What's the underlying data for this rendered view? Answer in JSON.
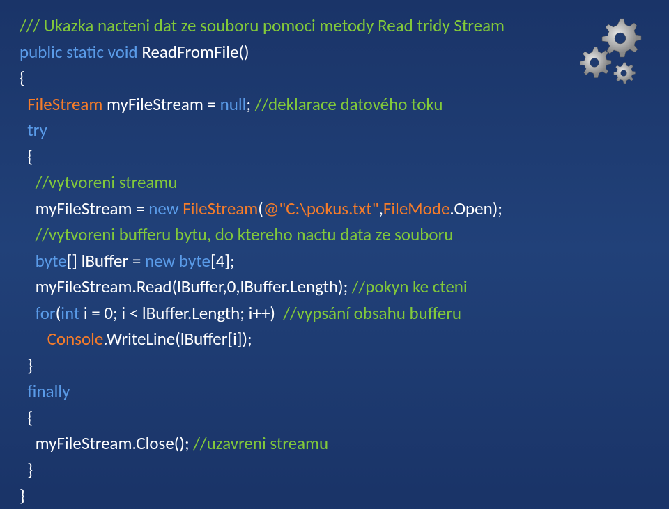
{
  "code": {
    "l1": "/// Ukazka nacteni dat ze souboru pomoci metody Read tridy Stream",
    "l2a": "public static void ",
    "l2b": "ReadFromFile",
    "l2c": "()",
    "l3": "{",
    "l4a": "  FileStream ",
    "l4b": "myFileStream = ",
    "l4c": "null",
    "l4d": "; ",
    "l4e": "//deklarace datového toku",
    "l5": "  try",
    "l6": "  {",
    "l7": "    //vytvoreni streamu",
    "l8a": "    myFileStream = ",
    "l8b": "new ",
    "l8c": "FileStream",
    "l8d": "(",
    "l8e": "@\"C:\\pokus.txt\"",
    "l8f": ",",
    "l8g": "FileMode",
    "l8h": ".Open);",
    "l9": "    //vytvoreni bufferu bytu, do ktereho nactu data ze souboru",
    "l10a": "    byte",
    "l10b": "[] lBuffer = ",
    "l10c": "new byte",
    "l10d": "[4];",
    "l11a": "    myFileStream.Read(lBuffer,0,lBuffer.Length); ",
    "l11b": "//pokyn ke cteni",
    "l12a": "    for",
    "l12b": "(",
    "l12c": "int ",
    "l12d": "i = 0; i < lBuffer.Length; i++) ",
    "l12e": " //vypsání obsahu bufferu",
    "l13a": "       Console",
    "l13b": ".WriteLine(lBuffer[i]);",
    "l14": "  }",
    "l15": "  finally",
    "l16": "  {",
    "l17a": "    myFileStream.Close(); ",
    "l17b": "//uzavreni streamu",
    "l18": "  }",
    "l19": "}"
  }
}
